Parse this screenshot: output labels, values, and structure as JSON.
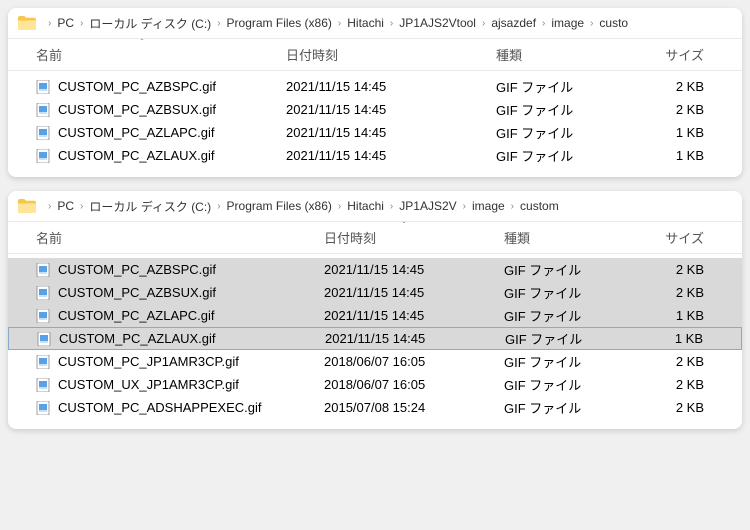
{
  "windows": [
    {
      "breadcrumb": [
        "PC",
        "ローカル ディスク (C:)",
        "Program Files (x86)",
        "Hitachi",
        "JP1AJS2Vtool",
        "ajsazdef",
        "image",
        "custo"
      ],
      "columns": {
        "name": "名前",
        "date": "日付時刻",
        "type": "種類",
        "size": "サイズ"
      },
      "sort_on": "name",
      "files": [
        {
          "name": "CUSTOM_PC_AZBSPC.gif",
          "date": "2021/11/15 14:45",
          "type": "GIF ファイル",
          "size": "2 KB",
          "selected": false
        },
        {
          "name": "CUSTOM_PC_AZBSUX.gif",
          "date": "2021/11/15 14:45",
          "type": "GIF ファイル",
          "size": "2 KB",
          "selected": false
        },
        {
          "name": "CUSTOM_PC_AZLAPC.gif",
          "date": "2021/11/15 14:45",
          "type": "GIF ファイル",
          "size": "1 KB",
          "selected": false
        },
        {
          "name": "CUSTOM_PC_AZLAUX.gif",
          "date": "2021/11/15 14:45",
          "type": "GIF ファイル",
          "size": "1 KB",
          "selected": false
        }
      ]
    },
    {
      "breadcrumb": [
        "PC",
        "ローカル ディスク (C:)",
        "Program Files (x86)",
        "Hitachi",
        "JP1AJS2V",
        "image",
        "custom"
      ],
      "columns": {
        "name": "名前",
        "date": "日付時刻",
        "type": "種類",
        "size": "サイズ"
      },
      "sort_on": "date",
      "files": [
        {
          "name": "CUSTOM_PC_AZBSPC.gif",
          "date": "2021/11/15 14:45",
          "type": "GIF ファイル",
          "size": "2 KB",
          "selected": true
        },
        {
          "name": "CUSTOM_PC_AZBSUX.gif",
          "date": "2021/11/15 14:45",
          "type": "GIF ファイル",
          "size": "2 KB",
          "selected": true
        },
        {
          "name": "CUSTOM_PC_AZLAPC.gif",
          "date": "2021/11/15 14:45",
          "type": "GIF ファイル",
          "size": "1 KB",
          "selected": true
        },
        {
          "name": "CUSTOM_PC_AZLAUX.gif",
          "date": "2021/11/15 14:45",
          "type": "GIF ファイル",
          "size": "1 KB",
          "selected": true,
          "last": true
        },
        {
          "name": "CUSTOM_PC_JP1AMR3CP.gif",
          "date": "2018/06/07 16:05",
          "type": "GIF ファイル",
          "size": "2 KB",
          "selected": false
        },
        {
          "name": "CUSTOM_UX_JP1AMR3CP.gif",
          "date": "2018/06/07 16:05",
          "type": "GIF ファイル",
          "size": "2 KB",
          "selected": false
        },
        {
          "name": "CUSTOM_PC_ADSHAPPEXEC.gif",
          "date": "2015/07/08 15:24",
          "type": "GIF ファイル",
          "size": "2 KB",
          "selected": false
        }
      ]
    }
  ]
}
